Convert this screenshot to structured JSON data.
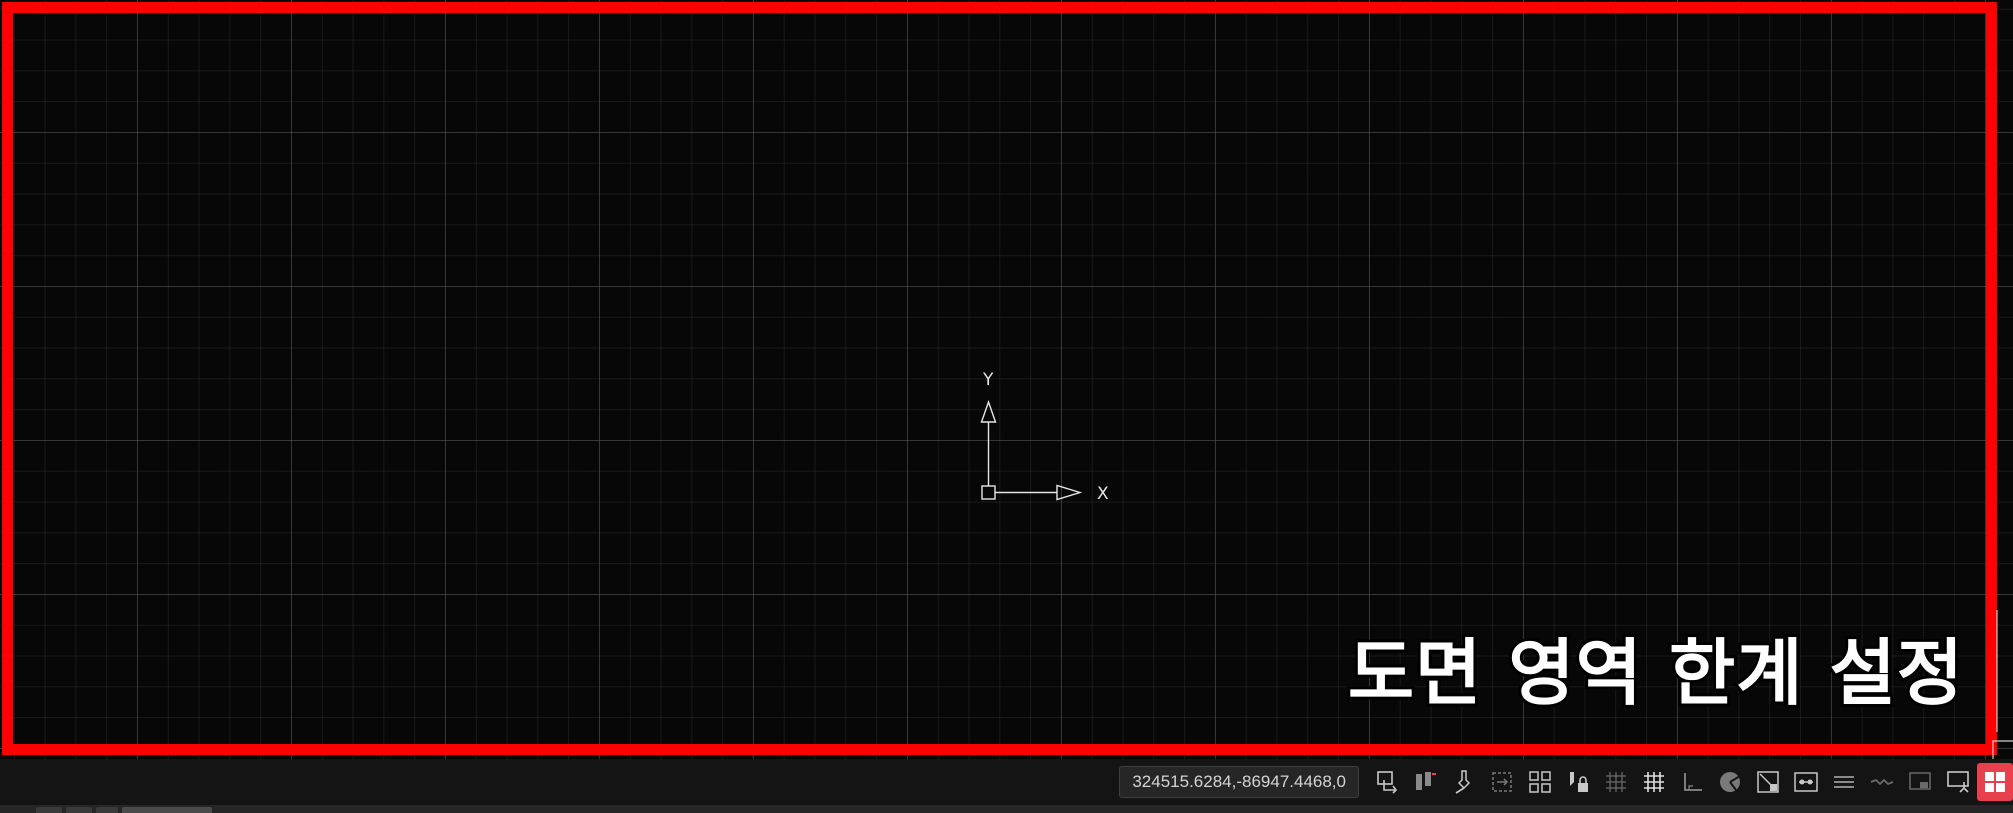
{
  "canvas": {
    "background": "#070707",
    "grid_major_color": "#5a5a5a",
    "grid_minor_color": "#3c3c3c"
  },
  "highlight": {
    "color": "#ff0000"
  },
  "ucs": {
    "x_label": "X",
    "y_label": "Y"
  },
  "overlay": {
    "caption": "도면 영역 한계 설정",
    "color": "#ffffff"
  },
  "status_bar": {
    "coordinates": "324515.6284,-86947.4468,0",
    "tools": [
      {
        "name": "model-space-icon"
      },
      {
        "name": "grid-display-icon"
      },
      {
        "name": "snap-mode-icon"
      },
      {
        "name": "infer-constraints-icon"
      },
      {
        "name": "dynamic-input-icon"
      },
      {
        "name": "ortho-lock-icon"
      },
      {
        "name": "grid-snap-icon"
      },
      {
        "name": "grid-icon"
      },
      {
        "name": "ortho-mode-icon"
      },
      {
        "name": "polar-tracking-icon"
      },
      {
        "name": "isometric-drafting-icon"
      },
      {
        "name": "object-snap-tracking-icon"
      },
      {
        "name": "lineweight-icon"
      },
      {
        "name": "transparency-icon"
      },
      {
        "name": "selection-cycling-icon"
      },
      {
        "name": "annotation-monitor-icon"
      }
    ],
    "accent": "#e8414e"
  }
}
